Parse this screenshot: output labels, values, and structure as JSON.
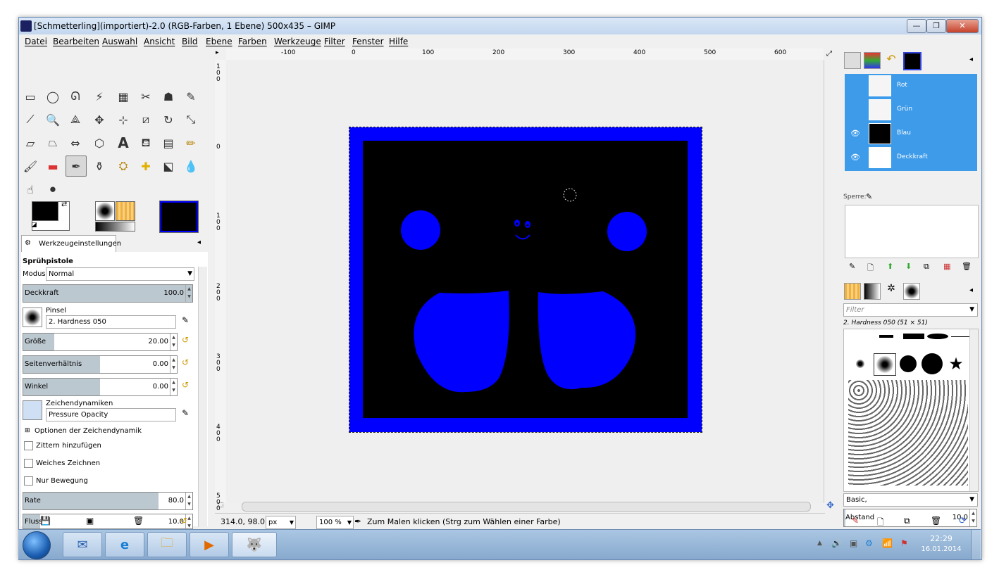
{
  "window": {
    "title": "[Schmetterling](importiert)-2.0 (RGB-Farben, 1 Ebene) 500x435 – GIMP",
    "minimize": "—",
    "maximize": "❐",
    "close": "✕"
  },
  "menu": [
    "Datei",
    "Bearbeiten",
    "Auswahl",
    "Ansicht",
    "Bild",
    "Ebene",
    "Farben",
    "Werkzeuge",
    "Filter",
    "Fenster",
    "Hilfe"
  ],
  "ruler_top_labels": [
    "-100",
    "0",
    "100",
    "200",
    "300",
    "400",
    "500",
    "600"
  ],
  "ruler_left_labels": [
    "1 0 0",
    "0",
    "1 0 0",
    "2 0 0",
    "3 0 0",
    "4 0 0",
    "5 0 0"
  ],
  "tool_options": {
    "tab_label": "Werkzeugeinstellungen",
    "tool_name": "Sprühpistole",
    "mode_label": "Modus:",
    "mode_value": "Normal",
    "opacity_label": "Deckkraft",
    "opacity_value": "100.0",
    "brush_label": "Pinsel",
    "brush_value": "2. Hardness 050",
    "size_label": "Größe",
    "size_value": "20.00",
    "aspect_label": "Seitenverhältnis",
    "aspect_value": "0.00",
    "angle_label": "Winkel",
    "angle_value": "0.00",
    "dynamics_label": "Zeichendynamiken",
    "dynamics_value": "Pressure Opacity",
    "dynamics_options": "Optionen der Zeichendynamik",
    "jitter": "Zittern hinzufügen",
    "smooth": "Weiches Zeichnen",
    "motion_only": "Nur Bewegung",
    "rate_label": "Rate",
    "rate_value": "80.0",
    "flow_label": "Fluss",
    "flow_value": "10.0"
  },
  "tool_option_levels": {
    "opacity": 1.0,
    "size": 0.2,
    "aspect": 0.5,
    "angle": 0.5,
    "rate": 0.8,
    "flow": 0.1
  },
  "status": {
    "coords": "314.0, 98.0",
    "unit": "px",
    "zoom": "100 %",
    "message": "Zum Malen klicken (Strg zum Wählen einer Farbe)"
  },
  "layers": [
    {
      "name": "Rot",
      "visible": false
    },
    {
      "name": "Grün",
      "visible": false
    },
    {
      "name": "Blau",
      "visible": true
    },
    {
      "name": "Deckkraft",
      "visible": true
    }
  ],
  "lock_label": "Sperre:",
  "brushes_panel": {
    "filter_placeholder": "Filter",
    "selected_brush": "2. Hardness 050 (51 × 51)",
    "tag_value": "Basic,",
    "spacing_label": "Abstand",
    "spacing_value": "10.0"
  },
  "taskbar": {
    "time": "22:29",
    "date": "16.01.2014"
  },
  "colors": {
    "image_border": "#0000ff",
    "image_fill": "#000000",
    "layer_selected": "#3d9be9"
  }
}
